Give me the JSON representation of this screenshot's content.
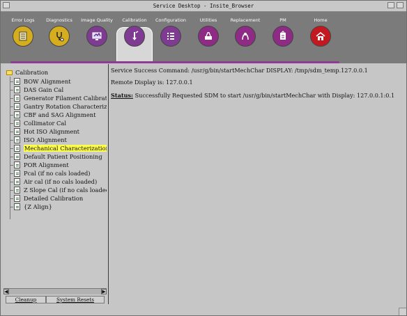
{
  "window": {
    "title": "Service Desktop - Insite_Browser"
  },
  "toolbar": {
    "items": [
      {
        "label": "Error Logs",
        "icon": "log-icon",
        "color": "#d6ad1d"
      },
      {
        "label": "Diagnostics",
        "icon": "stethoscope-icon",
        "color": "#d6ad1d"
      },
      {
        "label": "Image Quality",
        "icon": "monitor-icon",
        "color": "#7f3b92"
      },
      {
        "label": "Calibration",
        "icon": "calibration-icon",
        "color": "#7f3b92"
      },
      {
        "label": "Configuration",
        "icon": "list-icon",
        "color": "#7f3b92"
      },
      {
        "label": "Utilities",
        "icon": "utilities-icon",
        "color": "#8e2b84"
      },
      {
        "label": "Replacement",
        "icon": "replacement-icon",
        "color": "#8e2b84"
      },
      {
        "label": "PM",
        "icon": "pm-icon",
        "color": "#8e2b84"
      },
      {
        "label": "Home",
        "icon": "home-icon",
        "color": "#c41820"
      }
    ]
  },
  "tree": {
    "root": "Calibration",
    "items": [
      "BOW Alignment",
      "DAS Gain Cal",
      "Generator Filament Calibration",
      "Gantry Rotation Characterizatic",
      "CBF and SAG Alignment",
      "Collimator Cal",
      "Hot ISO Alignment",
      "ISO Alignment",
      "Mechanical Characterization",
      "Default Patient Positioning",
      "POR Alignment",
      "Pcal (if no cals loaded)",
      "Air cal (if no cals loaded)",
      "Z Slope Cal (if no cals loaded)",
      "Detailed Calibration",
      "{Z Align}"
    ],
    "selected_index": 8
  },
  "buttons": {
    "cleanup": "Cleanup",
    "system_resets": "System Resets"
  },
  "content": {
    "line1": "Service Success Command: /usr/g/bin/startMechChar DISPLAY: /tmp/sdm_temp.127.0.0.1",
    "line2": "Remote Display is: 127.0.0.1",
    "status_label": "Status:",
    "status_text": " Successfully Requested SDM to start /usr/g/bin/startMechChar with Display: 127.0.0.1:0.1"
  }
}
